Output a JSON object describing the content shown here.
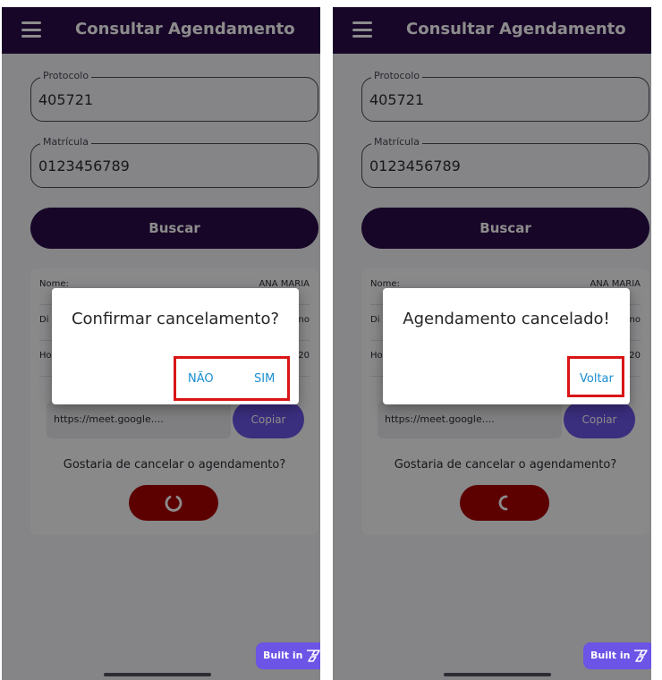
{
  "app_title": "Consultar Agendamento",
  "protocol": {
    "label": "Protocolo",
    "value": "405721"
  },
  "registration": {
    "label": "Matrícula",
    "value": "0123456789"
  },
  "search_button": "Buscar",
  "details": {
    "name_label": "Nome:",
    "name_value": "ANA MARIA",
    "row2_label": "Di",
    "row2_value": "no",
    "row3_label": "Ho",
    "row3_value": "20"
  },
  "meeting_link": "https://meet.google....",
  "copy_button": "Copiar",
  "cancel_question": "Gostaria de cancelar o agendamento?",
  "left_dialog": {
    "title": "Confirmar cancelamento?",
    "no": "NÃO",
    "yes": "SIM"
  },
  "right_dialog": {
    "title": "Agendamento cancelado!",
    "back": "Voltar"
  },
  "built_badge": "Built in",
  "colors": {
    "appbar": "#2b0b4a",
    "accent": "#6b54e6",
    "danger": "#a80000",
    "action_text": "#1a8fd0",
    "highlight": "#d91515"
  }
}
